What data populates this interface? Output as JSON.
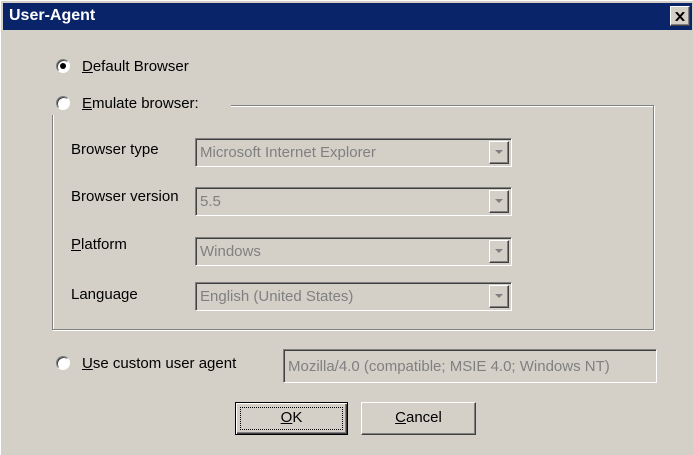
{
  "window": {
    "title": "User-Agent",
    "close_glyph": "✕"
  },
  "options": {
    "default_browser": {
      "prefix": "D",
      "rest": "efault Browser",
      "selected": true
    },
    "emulate_browser": {
      "prefix": "E",
      "rest": "mulate browser:",
      "selected": false
    },
    "custom_user_agent": {
      "prefix": "U",
      "rest": "se custom user agent",
      "selected": false
    }
  },
  "emulate": {
    "browser_type": {
      "label": "Browser type",
      "value": "Microsoft Internet Explorer"
    },
    "browser_version": {
      "label": "Browser version",
      "value": "5.5"
    },
    "platform": {
      "label_prefix": "P",
      "label_rest": "latform",
      "value": "Windows"
    },
    "language": {
      "label": "Language",
      "value": "English (United States)"
    }
  },
  "custom_user_agent": {
    "value": "Mozilla/4.0 (compatible; MSIE 4.0; Windows NT)"
  },
  "buttons": {
    "ok": {
      "prefix": "O",
      "rest": "K"
    },
    "cancel": {
      "prefix": "C",
      "rest": "ancel"
    }
  },
  "colors": {
    "titlebar": "#0a246a",
    "face": "#d4d0c8",
    "disabled_text": "#808080"
  },
  "icons": {
    "close": "close-icon",
    "dropdown": "chevron-down-icon"
  }
}
